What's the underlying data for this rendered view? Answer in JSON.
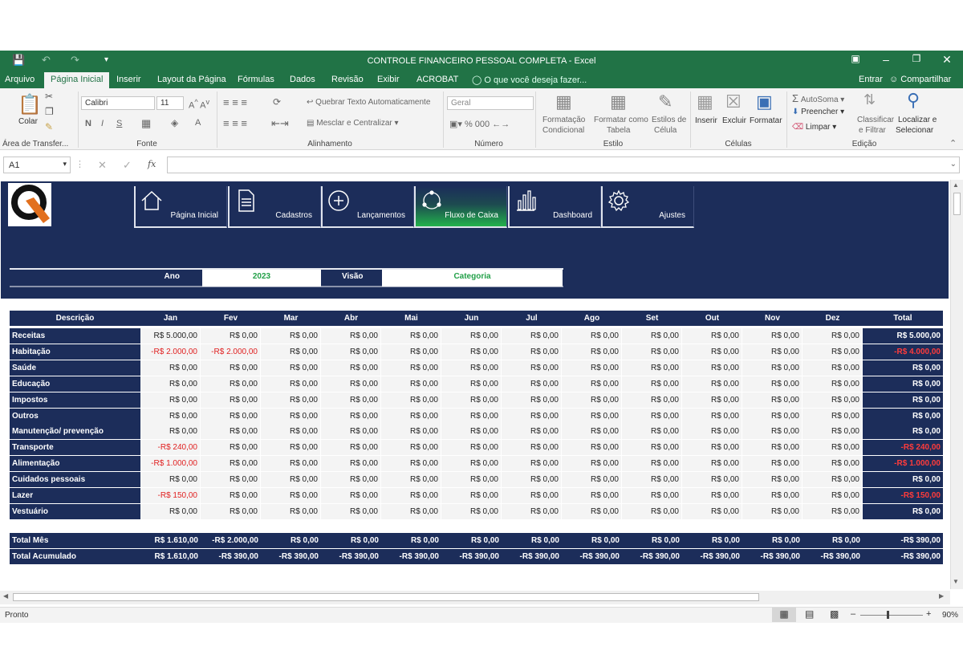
{
  "window": {
    "title": "CONTROLE FINANCEIRO PESSOAL COMPLETA - Excel"
  },
  "ribbon_tabs": [
    "Arquivo",
    "Página Inicial",
    "Inserir",
    "Layout da Página",
    "Fórmulas",
    "Dados",
    "Revisão",
    "Exibir",
    "ACROBAT"
  ],
  "tell_me": "O que você deseja fazer...",
  "account": {
    "signin": "Entrar",
    "share": "Compartilhar"
  },
  "ribbon": {
    "clipboard": {
      "paste": "Colar",
      "group": "Área de Transfer..."
    },
    "font": {
      "name": "Calibri",
      "size": "11",
      "group": "Fonte",
      "bold": "N",
      "italic": "I",
      "underline": "S"
    },
    "alignment": {
      "wrap": "Quebrar Texto Automaticamente",
      "merge": "Mesclar e Centralizar",
      "group": "Alinhamento"
    },
    "number": {
      "format": "Geral",
      "group": "Número"
    },
    "styles": {
      "cond1": "Formatação",
      "cond2": "Condicional",
      "table1": "Formatar como",
      "table2": "Tabela",
      "cell1": "Estilos de",
      "cell2": "Célula",
      "group": "Estilo"
    },
    "cells": {
      "insert": "Inserir",
      "delete": "Excluir",
      "format": "Formatar",
      "group": "Células"
    },
    "editing": {
      "autosum": "AutoSoma",
      "fill": "Preencher",
      "clear": "Limpar",
      "sort1": "Classificar",
      "sort2": "e Filtrar",
      "find1": "Localizar e",
      "find2": "Selecionar",
      "group": "Edição"
    }
  },
  "formula_bar": {
    "cell_ref": "A1",
    "fx": "fx",
    "content": ""
  },
  "nav": [
    {
      "label": "Página Inicial",
      "icon": "home-icon"
    },
    {
      "label": "Cadastros",
      "icon": "document-icon"
    },
    {
      "label": "Lançamentos",
      "icon": "plus-circle-icon"
    },
    {
      "label": "Fluxo de Caixa",
      "icon": "cycle-icon",
      "active": true
    },
    {
      "label": "Dashboard",
      "icon": "bar-chart-icon"
    },
    {
      "label": "Ajustes",
      "icon": "gear-icon"
    }
  ],
  "filters": {
    "year_label": "Ano",
    "year_value": "2023",
    "view_label": "Visão",
    "view_value": "Categoria"
  },
  "table": {
    "headers": [
      "Descrição",
      "Jan",
      "Fev",
      "Mar",
      "Abr",
      "Mai",
      "Jun",
      "Jul",
      "Ago",
      "Set",
      "Out",
      "Nov",
      "Dez",
      "Total"
    ],
    "rows": [
      {
        "label": "Receitas",
        "values": [
          "R$ 5.000,00",
          "R$ 0,00",
          "R$ 0,00",
          "R$ 0,00",
          "R$ 0,00",
          "R$ 0,00",
          "R$ 0,00",
          "R$ 0,00",
          "R$ 0,00",
          "R$ 0,00",
          "R$ 0,00",
          "R$ 0,00"
        ],
        "total": "R$ 5.000,00"
      },
      {
        "label": "Habitação",
        "values": [
          "-R$ 2.000,00",
          "-R$ 2.000,00",
          "R$ 0,00",
          "R$ 0,00",
          "R$ 0,00",
          "R$ 0,00",
          "R$ 0,00",
          "R$ 0,00",
          "R$ 0,00",
          "R$ 0,00",
          "R$ 0,00",
          "R$ 0,00"
        ],
        "total": "-R$ 4.000,00"
      },
      {
        "label": "Saúde",
        "values": [
          "R$ 0,00",
          "R$ 0,00",
          "R$ 0,00",
          "R$ 0,00",
          "R$ 0,00",
          "R$ 0,00",
          "R$ 0,00",
          "R$ 0,00",
          "R$ 0,00",
          "R$ 0,00",
          "R$ 0,00",
          "R$ 0,00"
        ],
        "total": "R$ 0,00"
      },
      {
        "label": "Educação",
        "values": [
          "R$ 0,00",
          "R$ 0,00",
          "R$ 0,00",
          "R$ 0,00",
          "R$ 0,00",
          "R$ 0,00",
          "R$ 0,00",
          "R$ 0,00",
          "R$ 0,00",
          "R$ 0,00",
          "R$ 0,00",
          "R$ 0,00"
        ],
        "total": "R$ 0,00"
      },
      {
        "label": "Impostos",
        "values": [
          "R$ 0,00",
          "R$ 0,00",
          "R$ 0,00",
          "R$ 0,00",
          "R$ 0,00",
          "R$ 0,00",
          "R$ 0,00",
          "R$ 0,00",
          "R$ 0,00",
          "R$ 0,00",
          "R$ 0,00",
          "R$ 0,00"
        ],
        "total": "R$ 0,00"
      },
      {
        "label": "Outros",
        "values": [
          "R$ 0,00",
          "R$ 0,00",
          "R$ 0,00",
          "R$ 0,00",
          "R$ 0,00",
          "R$ 0,00",
          "R$ 0,00",
          "R$ 0,00",
          "R$ 0,00",
          "R$ 0,00",
          "R$ 0,00",
          "R$ 0,00"
        ],
        "total": "R$ 0,00"
      },
      {
        "label": "Manutenção/ prevenção",
        "values": [
          "R$ 0,00",
          "R$ 0,00",
          "R$ 0,00",
          "R$ 0,00",
          "R$ 0,00",
          "R$ 0,00",
          "R$ 0,00",
          "R$ 0,00",
          "R$ 0,00",
          "R$ 0,00",
          "R$ 0,00",
          "R$ 0,00"
        ],
        "total": "R$ 0,00"
      },
      {
        "label": "Transporte",
        "values": [
          "-R$ 240,00",
          "R$ 0,00",
          "R$ 0,00",
          "R$ 0,00",
          "R$ 0,00",
          "R$ 0,00",
          "R$ 0,00",
          "R$ 0,00",
          "R$ 0,00",
          "R$ 0,00",
          "R$ 0,00",
          "R$ 0,00"
        ],
        "total": "-R$ 240,00"
      },
      {
        "label": "Alimentação",
        "values": [
          "-R$ 1.000,00",
          "R$ 0,00",
          "R$ 0,00",
          "R$ 0,00",
          "R$ 0,00",
          "R$ 0,00",
          "R$ 0,00",
          "R$ 0,00",
          "R$ 0,00",
          "R$ 0,00",
          "R$ 0,00",
          "R$ 0,00"
        ],
        "total": "-R$ 1.000,00"
      },
      {
        "label": "Cuidados pessoais",
        "values": [
          "R$ 0,00",
          "R$ 0,00",
          "R$ 0,00",
          "R$ 0,00",
          "R$ 0,00",
          "R$ 0,00",
          "R$ 0,00",
          "R$ 0,00",
          "R$ 0,00",
          "R$ 0,00",
          "R$ 0,00",
          "R$ 0,00"
        ],
        "total": "R$ 0,00"
      },
      {
        "label": "Lazer",
        "values": [
          "-R$ 150,00",
          "R$ 0,00",
          "R$ 0,00",
          "R$ 0,00",
          "R$ 0,00",
          "R$ 0,00",
          "R$ 0,00",
          "R$ 0,00",
          "R$ 0,00",
          "R$ 0,00",
          "R$ 0,00",
          "R$ 0,00"
        ],
        "total": "-R$ 150,00"
      },
      {
        "label": "Vestuário",
        "values": [
          "R$ 0,00",
          "R$ 0,00",
          "R$ 0,00",
          "R$ 0,00",
          "R$ 0,00",
          "R$ 0,00",
          "R$ 0,00",
          "R$ 0,00",
          "R$ 0,00",
          "R$ 0,00",
          "R$ 0,00",
          "R$ 0,00"
        ],
        "total": "R$ 0,00"
      }
    ],
    "summary": [
      {
        "label": "Total Mês",
        "values": [
          "R$ 1.610,00",
          "-R$ 2.000,00",
          "R$ 0,00",
          "R$ 0,00",
          "R$ 0,00",
          "R$ 0,00",
          "R$ 0,00",
          "R$ 0,00",
          "R$ 0,00",
          "R$ 0,00",
          "R$ 0,00",
          "R$ 0,00"
        ],
        "total": "-R$ 390,00"
      },
      {
        "label": "Total Acumulado",
        "values": [
          "R$ 1.610,00",
          "-R$ 390,00",
          "-R$ 390,00",
          "-R$ 390,00",
          "-R$ 390,00",
          "-R$ 390,00",
          "-R$ 390,00",
          "-R$ 390,00",
          "-R$ 390,00",
          "-R$ 390,00",
          "-R$ 390,00",
          "-R$ 390,00"
        ],
        "total": "-R$ 390,00"
      }
    ]
  },
  "status": {
    "text": "Pronto",
    "zoom": "90%"
  },
  "colors": {
    "excel_green": "#217346",
    "navy": "#1c2d5a",
    "negative": "#e02020",
    "accent_green": "#22a048"
  }
}
